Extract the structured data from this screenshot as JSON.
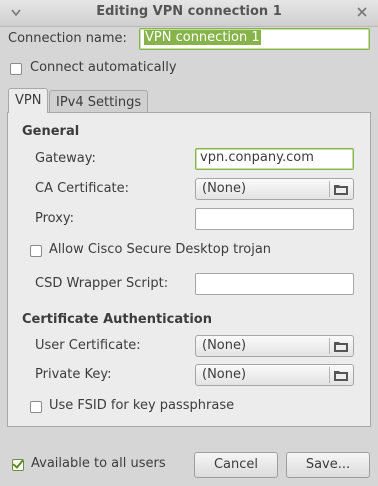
{
  "window": {
    "title": "Editing VPN connection 1"
  },
  "connection": {
    "name_label": "Connection name:",
    "name_value": "VPN connection 1",
    "connect_auto_label": "Connect automatically",
    "connect_auto_checked": false
  },
  "tabs": [
    {
      "label": "VPN",
      "active": true
    },
    {
      "label": "IPv4 Settings",
      "active": false
    }
  ],
  "general": {
    "heading": "General",
    "gateway_label": "Gateway:",
    "gateway_value": "vpn.conpany.com",
    "ca_cert_label": "CA Certificate:",
    "ca_cert_value": "(None)",
    "proxy_label": "Proxy:",
    "proxy_value": "",
    "allow_csd_label": "Allow Cisco Secure Desktop trojan",
    "allow_csd_checked": false,
    "csd_wrapper_label": "CSD Wrapper Script:",
    "csd_wrapper_value": ""
  },
  "cert_auth": {
    "heading": "Certificate Authentication",
    "user_cert_label": "User Certificate:",
    "user_cert_value": "(None)",
    "private_key_label": "Private Key:",
    "private_key_value": "(None)",
    "fsid_label": "Use FSID for key passphrase",
    "fsid_checked": false
  },
  "footer": {
    "available_label": "Available to all users",
    "available_checked": true,
    "cancel_label": "Cancel",
    "save_label": "Save..."
  },
  "colors": {
    "accent": "#86b44b",
    "window_bg": "#d6d6d6",
    "panel_bg": "#ececec"
  },
  "icons": {
    "menu": "chevron-down-icon",
    "close": "close-icon",
    "file_chooser": "folder-icon"
  }
}
